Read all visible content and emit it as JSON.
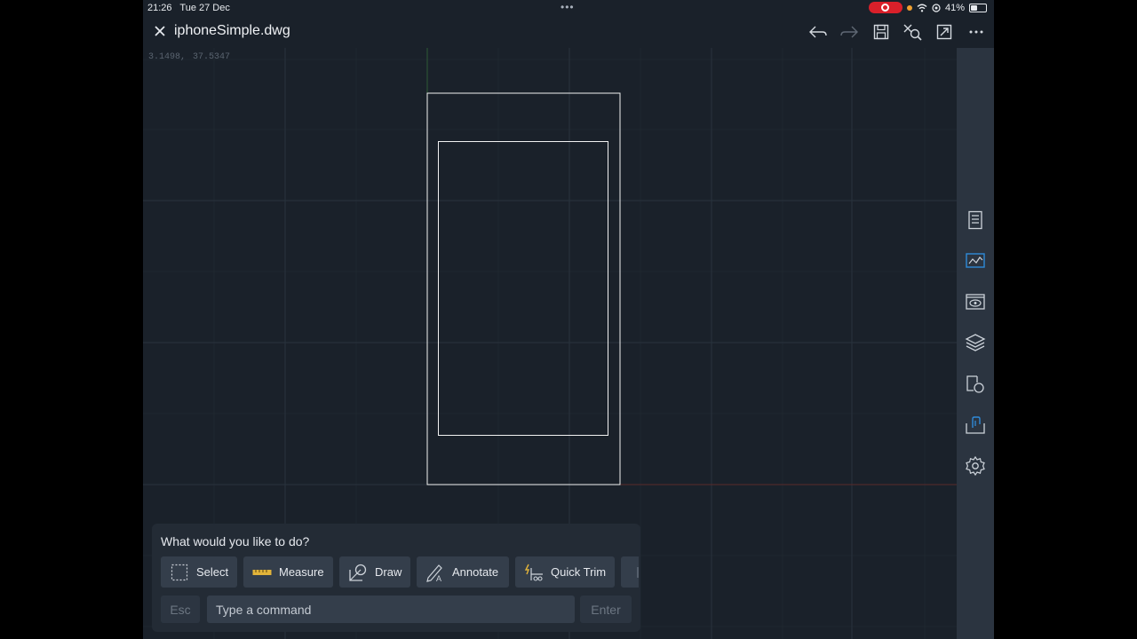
{
  "status_bar": {
    "time": "21:26",
    "date": "Tue 27 Dec",
    "battery": "41%",
    "battery_level": 0.41
  },
  "header": {
    "title": "iphoneSimple.dwg",
    "icons": [
      "close-icon",
      "undo-icon",
      "redo-icon",
      "save-icon",
      "zoom-extents-icon",
      "fullscreen-icon",
      "more-icon"
    ]
  },
  "canvas": {
    "coord_x": "3.1498,",
    "coord_y": "37.5347"
  },
  "side_toolbar": {
    "icons": [
      "properties-icon",
      "sheets-icon",
      "view-icon",
      "layers-icon",
      "blocks-icon",
      "xref-icon",
      "settings-icon"
    ]
  },
  "command": {
    "prompt": "What would you like to do?",
    "actions": [
      {
        "label": "Select",
        "icon": "select-icon"
      },
      {
        "label": "Measure",
        "icon": "ruler-icon"
      },
      {
        "label": "Draw",
        "icon": "draw-icon"
      },
      {
        "label": "Annotate",
        "icon": "annotate-icon"
      },
      {
        "label": "Quick Trim",
        "icon": "trim-icon"
      }
    ],
    "esc_label": "Esc",
    "input_placeholder": "Type a command",
    "enter_label": "Enter"
  },
  "colors": {
    "canvas_bg": "#1a212a",
    "toolbar_bg": "#2b3440",
    "record": "#d9202a",
    "geometry": "#ffffff"
  }
}
